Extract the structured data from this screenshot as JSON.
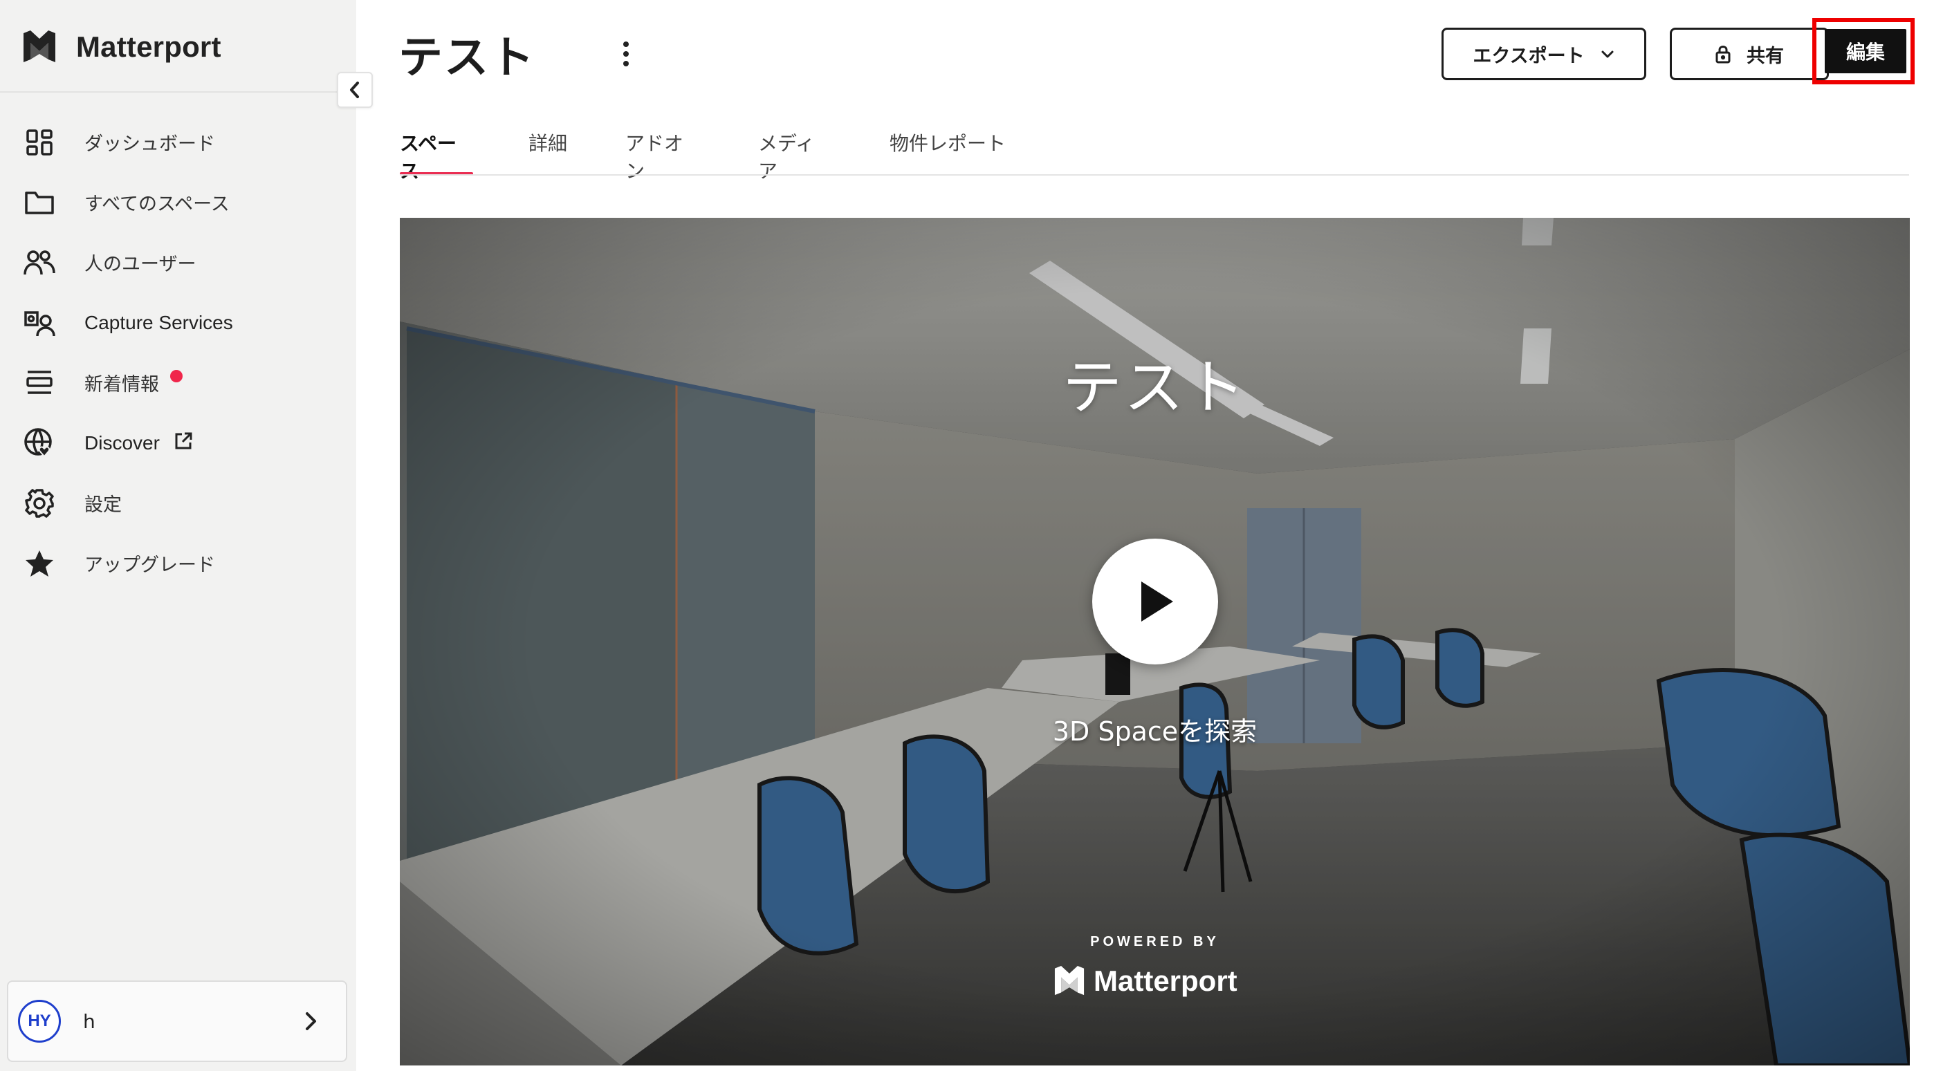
{
  "app": {
    "brand_name": "Matterport",
    "accent_color": "#ea2d52"
  },
  "sidebar": {
    "items": [
      {
        "label": "ダッシュボード",
        "icon": "dashboard-icon"
      },
      {
        "label": "すべてのスペース",
        "icon": "folder-icon"
      },
      {
        "label": "人のユーザー",
        "icon": "users-icon"
      },
      {
        "label": "Capture Services",
        "icon": "capture-services-icon"
      },
      {
        "label": "新着情報",
        "icon": "whats-new-icon",
        "badge": "red-dot"
      },
      {
        "label": "Discover",
        "icon": "globe-heart-icon",
        "external": true
      },
      {
        "label": "設定",
        "icon": "gear-icon"
      },
      {
        "label": "アップグレード",
        "icon": "star-icon"
      }
    ],
    "user": {
      "initials": "HY",
      "name": "h"
    }
  },
  "header": {
    "title": "テスト",
    "export_label": "エクスポート",
    "share_label": "共有",
    "edit_label": "編集"
  },
  "tabs": [
    {
      "label": "スペース",
      "active": true
    },
    {
      "label": "詳細",
      "active": false
    },
    {
      "label": "アドオン",
      "active": false
    },
    {
      "label": "メディア",
      "active": false
    },
    {
      "label": "物件レポート",
      "active": false
    }
  ],
  "viewer": {
    "title": "テスト",
    "explore_label": "3D Spaceを探索",
    "powered_by": "POWERED BY",
    "powered_brand": "Matterport"
  },
  "highlight_color": "#ee0000"
}
